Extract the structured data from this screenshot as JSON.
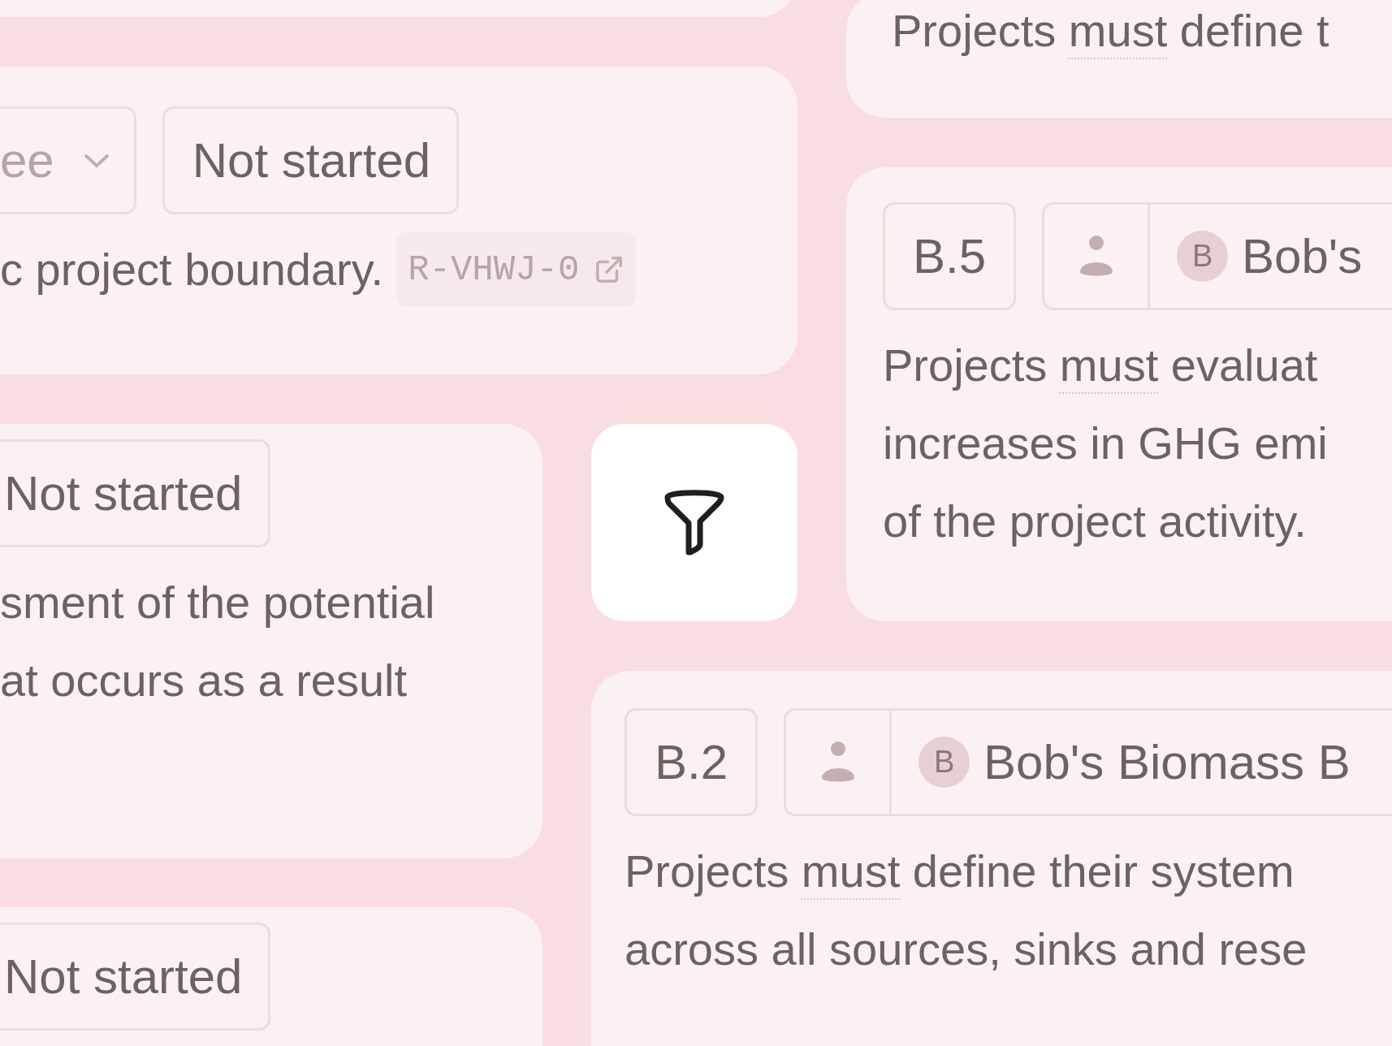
{
  "cards": [
    {
      "kind": "card"
    },
    {
      "kind": "card",
      "description": [
        [
          {
            "t": "Projects "
          },
          {
            "t": "must",
            "term": true
          },
          {
            "t": " define t"
          }
        ]
      ]
    },
    {
      "kind": "card",
      "assignee_select": {
        "placeholder": "ee"
      },
      "status": "Not started",
      "description": [
        [
          {
            "t": "c project boundary."
          }
        ]
      ],
      "reference": "R-VHWJ-0"
    },
    {
      "kind": "card",
      "code": "B.5",
      "assignee": {
        "initial": "B",
        "name": "Bob's"
      },
      "description": [
        [
          {
            "t": "Projects "
          },
          {
            "t": "must",
            "term": true
          },
          {
            "t": " evaluat"
          }
        ],
        [
          {
            "t": "increases in GHG emi"
          }
        ],
        [
          {
            "t": "of the project activity."
          }
        ]
      ]
    },
    {
      "kind": "card",
      "status": "Not started",
      "description": [
        [
          {
            "t": "sment of the potential"
          }
        ],
        [
          {
            "t": "at occurs as a result"
          }
        ]
      ]
    },
    {
      "kind": "filter"
    },
    {
      "kind": "card",
      "code": "B.2",
      "assignee": {
        "initial": "B",
        "name": "Bob's Biomass B"
      },
      "description": [
        [
          {
            "t": "Projects "
          },
          {
            "t": "must",
            "term": true
          },
          {
            "t": " define their system"
          }
        ],
        [
          {
            "t": "across all sources, sinks and rese"
          }
        ]
      ]
    },
    {
      "kind": "card",
      "status": "Not started"
    }
  ]
}
